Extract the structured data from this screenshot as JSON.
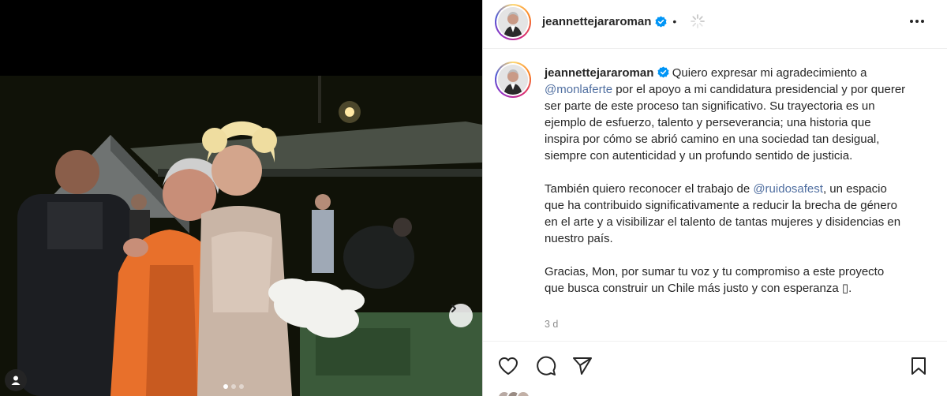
{
  "post": {
    "username": "jeannettejararoman",
    "time_ago": "3 d",
    "caption_paragraphs": [
      {
        "prefix": "Quiero expresar mi agradecimiento a ",
        "mention": "@monlaferte",
        "suffix": " por el apoyo a mi candidatura presidencial y por querer ser parte de este proceso tan significativo. Su trayectoria es un ejemplo de esfuerzo, talento y perseverancia; una historia que inspira por cómo se abrió camino en una sociedad tan desigual, siempre con autenticidad y un profundo sentido de justicia."
      },
      {
        "prefix": "También quiero reconocer el trabajo de ",
        "mention": "@ruidosafest",
        "suffix": ", un espacio que ha contribuido significativamente a reducir la brecha de género en el arte y a visibilizar el talento de tantas mujeres y disidencias en nuestro país."
      },
      {
        "text": "Gracias, Mon, por sumar tu voz y tu compromiso a este proyecto que busca construir un Chile más justo y con esperanza ▯."
      }
    ]
  },
  "header": {
    "bullet": "•"
  },
  "carousel": {
    "total_slides": 3,
    "active_slide": 1
  },
  "icons": {
    "verified": "verified-badge-icon",
    "more": "more-options-icon",
    "like": "heart-icon",
    "comment": "comment-icon",
    "share": "share-icon",
    "save": "bookmark-icon",
    "next": "chevron-right-icon",
    "tag": "user-tag-icon",
    "loading": "spinner-icon"
  },
  "colors": {
    "link": "#4f6ea0",
    "verified": "#0095f6",
    "muted": "#8e8e8e"
  }
}
